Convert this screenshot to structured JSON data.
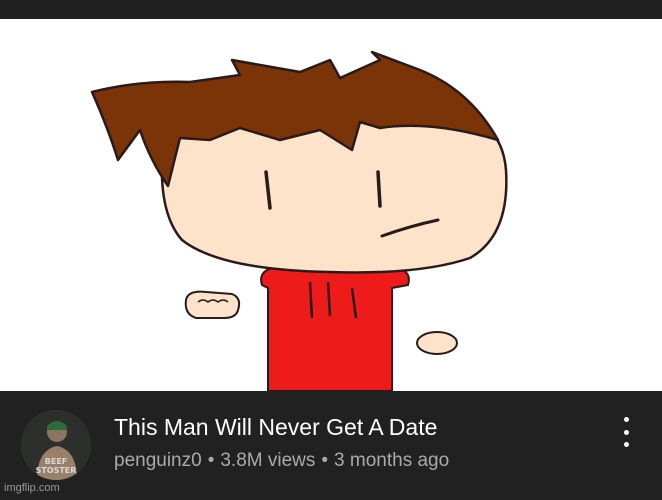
{
  "video": {
    "title": "This Man Will Never Get A Date",
    "channel": "penguinz0",
    "views": "3.8M views",
    "age": "3 months ago",
    "separator": "•"
  },
  "avatar": {
    "text_line1": "BEEF",
    "text_line2": "STOSTER"
  },
  "watermark": "imgflip.com",
  "icons": {
    "more": "more-vert-icon"
  },
  "colors": {
    "page_bg": "#212121",
    "title": "#ffffff",
    "meta": "#aaaaaa",
    "hair": "#7a3408",
    "skin": "#fde3c9",
    "shirt": "#ee1b1b"
  }
}
